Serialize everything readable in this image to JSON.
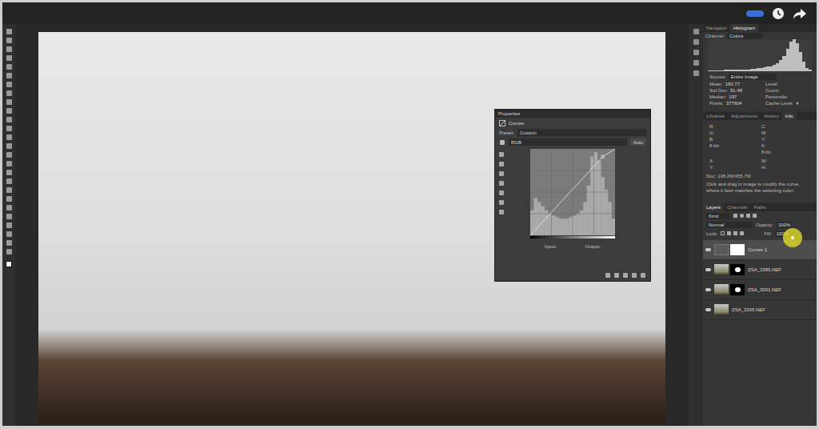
{
  "navigator_tabs": [
    {
      "label": "Navigator",
      "selected": false
    },
    {
      "label": "Histogram",
      "selected": true
    }
  ],
  "histogram": {
    "channel_label": "Channel:",
    "channel": "Colors",
    "source_label": "Source:",
    "source": "Entire Image",
    "values": [
      2,
      2,
      3,
      3,
      3,
      4,
      4,
      4,
      5,
      5,
      5,
      6,
      6,
      7,
      8,
      9,
      10,
      12,
      14,
      16,
      20,
      26,
      34,
      48,
      70,
      92,
      100,
      88,
      60,
      30,
      10,
      4
    ],
    "stats_left": [
      {
        "label": "Mean:",
        "value": "150.77"
      },
      {
        "label": "Std Dev:",
        "value": "51.48"
      },
      {
        "label": "Median:",
        "value": "197"
      },
      {
        "label": "Pixels:",
        "value": "377604"
      }
    ],
    "stats_right": [
      {
        "label": "Level:",
        "value": ""
      },
      {
        "label": "Count:",
        "value": ""
      },
      {
        "label": "Percentile:",
        "value": ""
      },
      {
        "label": "Cache Level:",
        "value": "4"
      }
    ]
  },
  "info_tabs": [
    {
      "label": "Libraries",
      "selected": false
    },
    {
      "label": "Adjustments",
      "selected": false
    },
    {
      "label": "History",
      "selected": false
    },
    {
      "label": "Info",
      "selected": true
    }
  ],
  "info": {
    "left": [
      "R:",
      "G:",
      "B:"
    ],
    "left_depth": "8-bit",
    "right": [
      "C:",
      "M:",
      "Y:",
      "K:"
    ],
    "right_depth": "8-bit",
    "pos": [
      "X:",
      "Y:"
    ],
    "size": [
      "W:",
      "H:"
    ],
    "doc": "Doc: 138.2M/455.7M",
    "hint": "Click and drag in image to modify the curve, where it best matches the selecting color."
  },
  "layers_tabs": [
    {
      "label": "Layers",
      "selected": true
    },
    {
      "label": "Channels",
      "selected": false
    },
    {
      "label": "Paths",
      "selected": false
    }
  ],
  "layers": {
    "filter": "Kind",
    "blend": "Normal",
    "opacity_label": "Opacity:",
    "opacity": "100%",
    "lock_label": "Lock:",
    "fill_label": "Fill:",
    "fill": "100%",
    "items": [
      {
        "name": "Curves 1",
        "kind": "adjustment",
        "visible": true,
        "selected": true
      },
      {
        "name": "ZSA_3385.NEF",
        "kind": "masked",
        "visible": true,
        "selected": false
      },
      {
        "name": "ZSA_3001.NEF",
        "kind": "masked",
        "visible": true,
        "selected": false
      },
      {
        "name": "ZSA_3305.NEF",
        "kind": "pixel",
        "visible": true,
        "selected": false
      }
    ]
  },
  "properties": {
    "title": "Properties",
    "adjustment": "Curves",
    "preset_label": "Preset:",
    "preset": "Custom",
    "channel": "RGB",
    "auto": "Auto",
    "input_label": "Input:",
    "output_label": "Output:",
    "curve": [
      [
        0,
        0
      ],
      [
        218,
        232
      ],
      [
        255,
        255
      ]
    ],
    "histogram": [
      30,
      45,
      40,
      35,
      30,
      26,
      24,
      22,
      20,
      20,
      20,
      22,
      24,
      26,
      30,
      40,
      60,
      95,
      100,
      90,
      70,
      55,
      40,
      20
    ]
  }
}
